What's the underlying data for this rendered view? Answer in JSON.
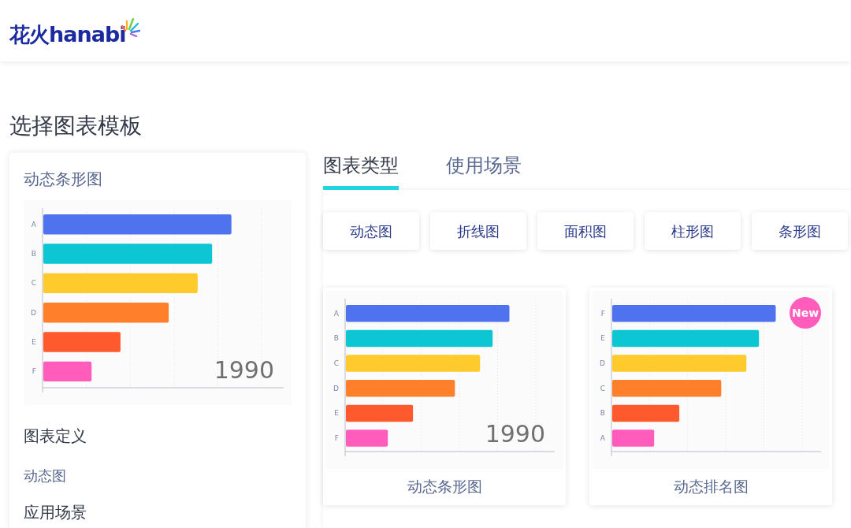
{
  "header": {
    "logo_cn": "花火",
    "logo_en": "hanabi"
  },
  "page_title": "选择图表模板",
  "preview": {
    "title": "动态条形图",
    "year": "1990",
    "bars": [
      {
        "label": "A",
        "color": "#4f73ef"
      },
      {
        "label": "B",
        "color": "#0cc6d4"
      },
      {
        "label": "C",
        "color": "#ffca2c"
      },
      {
        "label": "D",
        "color": "#ff7f2a"
      },
      {
        "label": "E",
        "color": "#ff5a2e"
      },
      {
        "label": "F",
        "color": "#ff5cbc"
      }
    ],
    "definition_heading": "图表定义",
    "definition": "动态图",
    "scenario_heading": "应用场景"
  },
  "tabs": [
    {
      "label": "图表类型",
      "selected": true
    },
    {
      "label": "使用场景",
      "selected": false
    }
  ],
  "categories": [
    "动态图",
    "折线图",
    "面积图",
    "柱形图",
    "条形图"
  ],
  "templates": [
    {
      "name": "动态条形图",
      "is_new": false,
      "year": "1990",
      "bars": [
        {
          "label": "A",
          "color": "#4f73ef"
        },
        {
          "label": "B",
          "color": "#0cc6d4"
        },
        {
          "label": "C",
          "color": "#ffca2c"
        },
        {
          "label": "D",
          "color": "#ff7f2a"
        },
        {
          "label": "E",
          "color": "#ff5a2e"
        },
        {
          "label": "F",
          "color": "#ff5cbc"
        }
      ]
    },
    {
      "name": "动态排名图",
      "is_new": true,
      "badge": "New",
      "bars": [
        {
          "label": "F",
          "color": "#4f73ef"
        },
        {
          "label": "E",
          "color": "#0cc6d4"
        },
        {
          "label": "D",
          "color": "#ffca2c"
        },
        {
          "label": "C",
          "color": "#ff7f2a"
        },
        {
          "label": "B",
          "color": "#ff5a2e"
        },
        {
          "label": "A",
          "color": "#ff5cbc"
        }
      ]
    }
  ]
}
